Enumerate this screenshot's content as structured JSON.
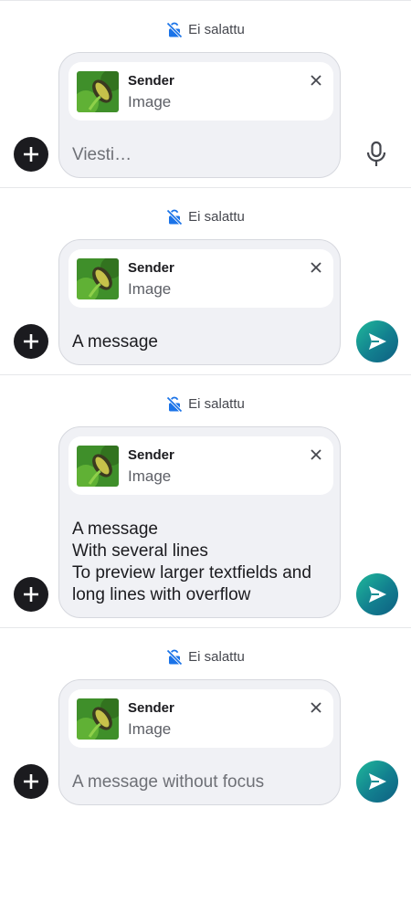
{
  "encryption_label": "Ei salattu",
  "composers": [
    {
      "reply": {
        "sender": "Sender",
        "type": "Image"
      },
      "text": "Viesti…",
      "text_is_placeholder": true,
      "action": "mic"
    },
    {
      "reply": {
        "sender": "Sender",
        "type": "Image"
      },
      "text": "A message",
      "text_is_placeholder": false,
      "action": "send"
    },
    {
      "reply": {
        "sender": "Sender",
        "type": "Image"
      },
      "text": "A message\nWith several lines\nTo preview larger textfields and long lines with overflow",
      "text_is_placeholder": false,
      "action": "send"
    },
    {
      "reply": {
        "sender": "Sender",
        "type": "Image"
      },
      "text": "A message without focus",
      "text_is_placeholder": true,
      "action": "send"
    }
  ],
  "colors": {
    "accent_blue": "#1a73e8",
    "send_gradient_start": "#1fb89a",
    "send_gradient_end": "#0f5f82",
    "field_bg": "#f0f1f5"
  },
  "icons": {
    "encryption": "no-encryption-lock-icon",
    "add": "add-icon",
    "mic": "microphone-icon",
    "send": "send-icon",
    "close": "close-icon"
  }
}
